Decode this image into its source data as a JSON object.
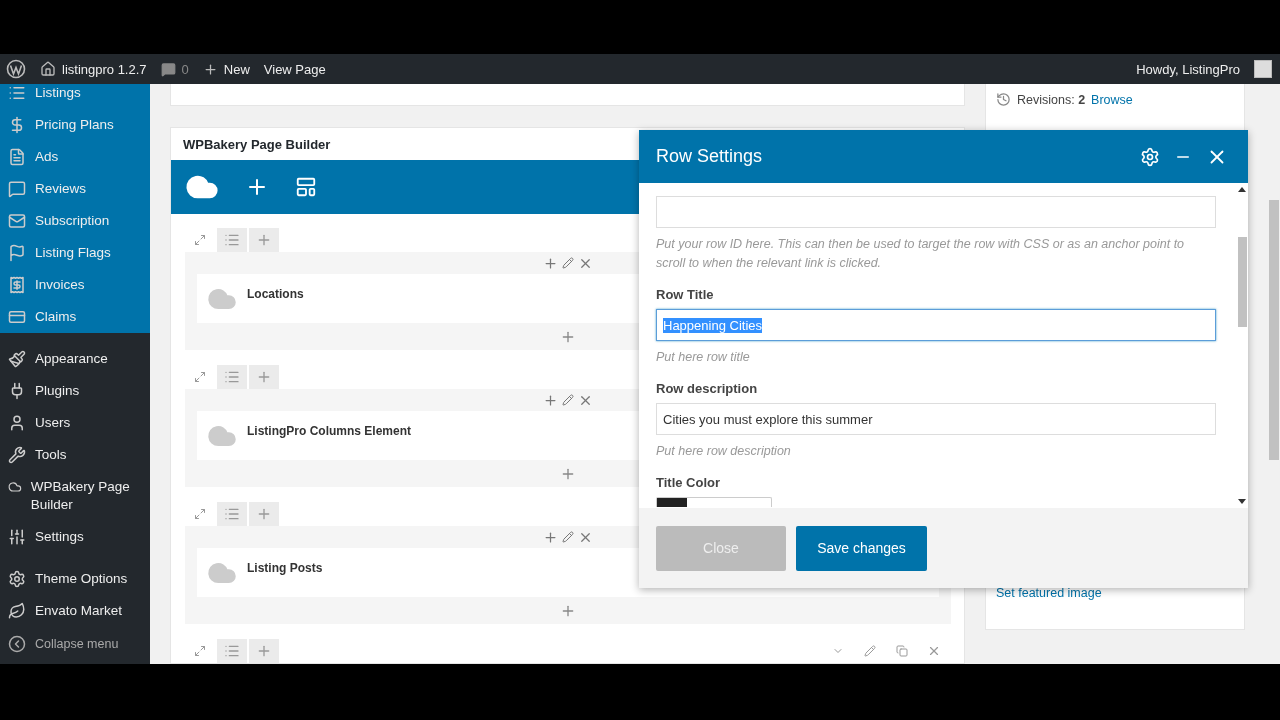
{
  "admin_bar": {
    "site": "listingpro 1.2.7",
    "comments": "0",
    "new": "New",
    "view": "View Page",
    "greeting": "Howdy, ListingPro"
  },
  "sidebar": {
    "items": [
      {
        "label": "Listings",
        "current": true
      },
      {
        "label": "Pricing Plans",
        "current": true
      },
      {
        "label": "Ads",
        "current": true
      },
      {
        "label": "Reviews",
        "current": true
      },
      {
        "label": "Subscription",
        "current": true
      },
      {
        "label": "Listing Flags",
        "current": true
      },
      {
        "label": "Invoices",
        "current": true
      },
      {
        "label": "Claims",
        "current": true
      },
      {
        "label": "Appearance",
        "current": false
      },
      {
        "label": "Plugins",
        "current": false
      },
      {
        "label": "Users",
        "current": false
      },
      {
        "label": "Tools",
        "current": false
      },
      {
        "label": "WPBakery Page Builder",
        "current": false
      },
      {
        "label": "Settings",
        "current": false
      },
      {
        "label": "Theme Options",
        "current": false
      },
      {
        "label": "Envato Market",
        "current": false
      }
    ],
    "collapse": "Collapse menu"
  },
  "builder": {
    "title": "WPBakery Page Builder",
    "rows": [
      {
        "element": "Locations"
      },
      {
        "element": "ListingPro Columns Element"
      },
      {
        "element": "Listing Posts"
      }
    ]
  },
  "publish_box": {
    "revisions": "Revisions: **2**",
    "browse": "Browse"
  },
  "featured_image": {
    "link": "Set featured image"
  },
  "modal": {
    "title": "Row Settings",
    "fields": [
      {
        "hint": "Put your row ID here. This can then be used to target the row with CSS or as an anchor point to scroll to when the relevant link is clicked.",
        "focused": false
      },
      {
        "label": "Row Title",
        "value": "Happening Cities",
        "focused": true,
        "text_selected": true,
        "hint": "Put here row title"
      },
      {
        "label": "Row description",
        "value": "Cities you must explore this summer",
        "focused": false,
        "text_selected": false,
        "hint": "Put here row description"
      }
    ],
    "color_label": "Title Color",
    "buttons": {
      "close": "Close",
      "save": "Save changes"
    }
  }
}
